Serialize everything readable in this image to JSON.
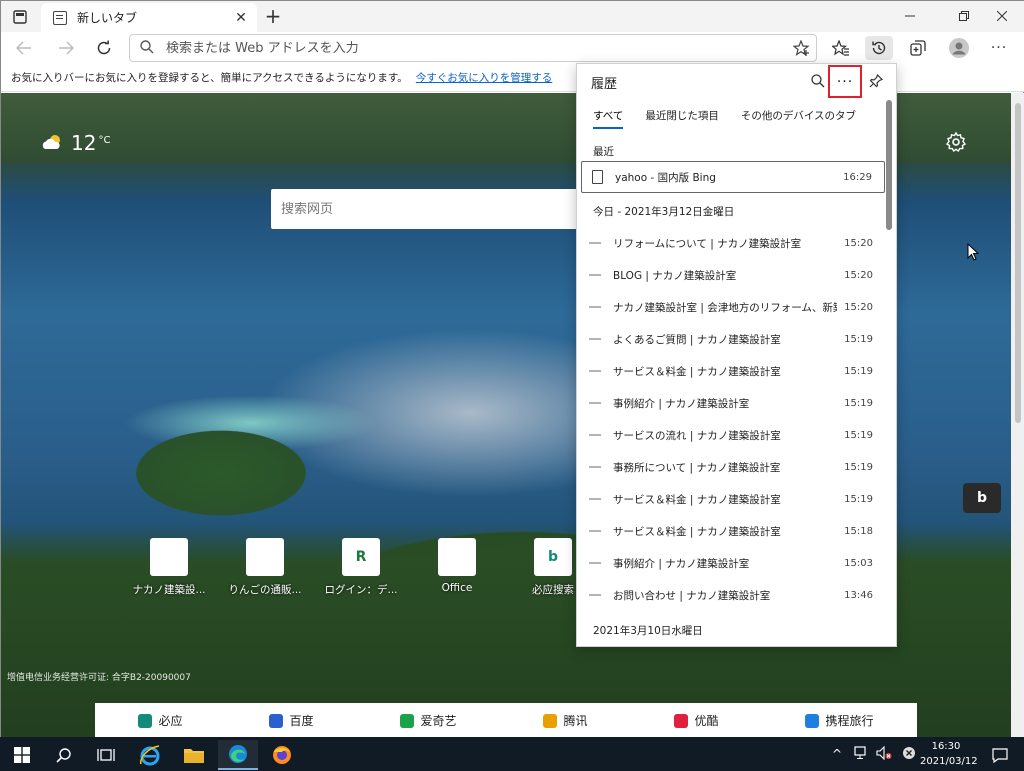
{
  "tab": {
    "title": "新しいタブ"
  },
  "address": {
    "placeholder": "検索または Web アドレスを入力"
  },
  "favbar": {
    "message": "お気に入りバーにお気に入りを登録すると、簡単にアクセスできるようになります。",
    "link": "今すぐお気に入りを管理する"
  },
  "newtab": {
    "weather_temp": "12",
    "weather_unit": "°C",
    "search_placeholder": "搜索网页",
    "quick_links": [
      {
        "label": "ナカノ建築設...",
        "tile": "",
        "color": "#dfe8ee"
      },
      {
        "label": "りんごの通販...",
        "tile": "",
        "color": "#a33a3a"
      },
      {
        "label": "ログイン：デ...",
        "tile": "R",
        "color": "#1e7a3c"
      },
      {
        "label": "Office",
        "tile": "",
        "color": "#d83b01"
      },
      {
        "label": "必应搜索",
        "tile": "b",
        "color": "#138a7a"
      }
    ],
    "license": "增值电信业务经营许可证: 合字B2-20090007",
    "bottom_links": [
      {
        "label": "必应",
        "color": "#138a7a"
      },
      {
        "label": "百度",
        "color": "#2a5fcf"
      },
      {
        "label": "爱奇艺",
        "color": "#1aa34a"
      },
      {
        "label": "腾讯",
        "color": "#e8a000"
      },
      {
        "label": "优酷",
        "color": "#e0203e"
      },
      {
        "label": "携程旅行",
        "color": "#1f7fe0"
      }
    ]
  },
  "history": {
    "title": "履歴",
    "more_label": "···",
    "tabs": [
      "すべて",
      "最近閉じた項目",
      "その他のデバイスのタブ"
    ],
    "recent_heading": "最近",
    "recent": {
      "label": "yahoo - 国内版 Bing",
      "time": "16:29"
    },
    "today_heading": "今日 - 2021年3月12日金曜日",
    "today": [
      {
        "label": "リフォームについて | ナカノ建築設計室",
        "time": "15:20"
      },
      {
        "label": "BLOG | ナカノ建築設計室",
        "time": "15:20"
      },
      {
        "label": "ナカノ建築設計室 | 会津地方のリフォーム、新築の設計...",
        "time": "15:20"
      },
      {
        "label": "よくあるご質問 | ナカノ建築設計室",
        "time": "15:19"
      },
      {
        "label": "サービス＆料金 | ナカノ建築設計室",
        "time": "15:19"
      },
      {
        "label": "事例紹介 | ナカノ建築設計室",
        "time": "15:19"
      },
      {
        "label": "サービスの流れ | ナカノ建築設計室",
        "time": "15:19"
      },
      {
        "label": "事務所について | ナカノ建築設計室",
        "time": "15:19"
      },
      {
        "label": "サービス＆料金 | ナカノ建築設計室",
        "time": "15:19"
      },
      {
        "label": "サービス＆料金 | ナカノ建築設計室",
        "time": "15:18"
      },
      {
        "label": "事例紹介 | ナカノ建築設計室",
        "time": "15:03"
      },
      {
        "label": "お問い合わせ | ナカノ建築設計室",
        "time": "13:46"
      }
    ],
    "older_heading": "2021年3月10日水曜日"
  },
  "taskbar": {
    "time": "16:30",
    "date": "2021/03/12"
  },
  "colors": {
    "accent": "#0a64c8",
    "highlight_border": "#e0202a",
    "taskbar": "#101b26"
  }
}
